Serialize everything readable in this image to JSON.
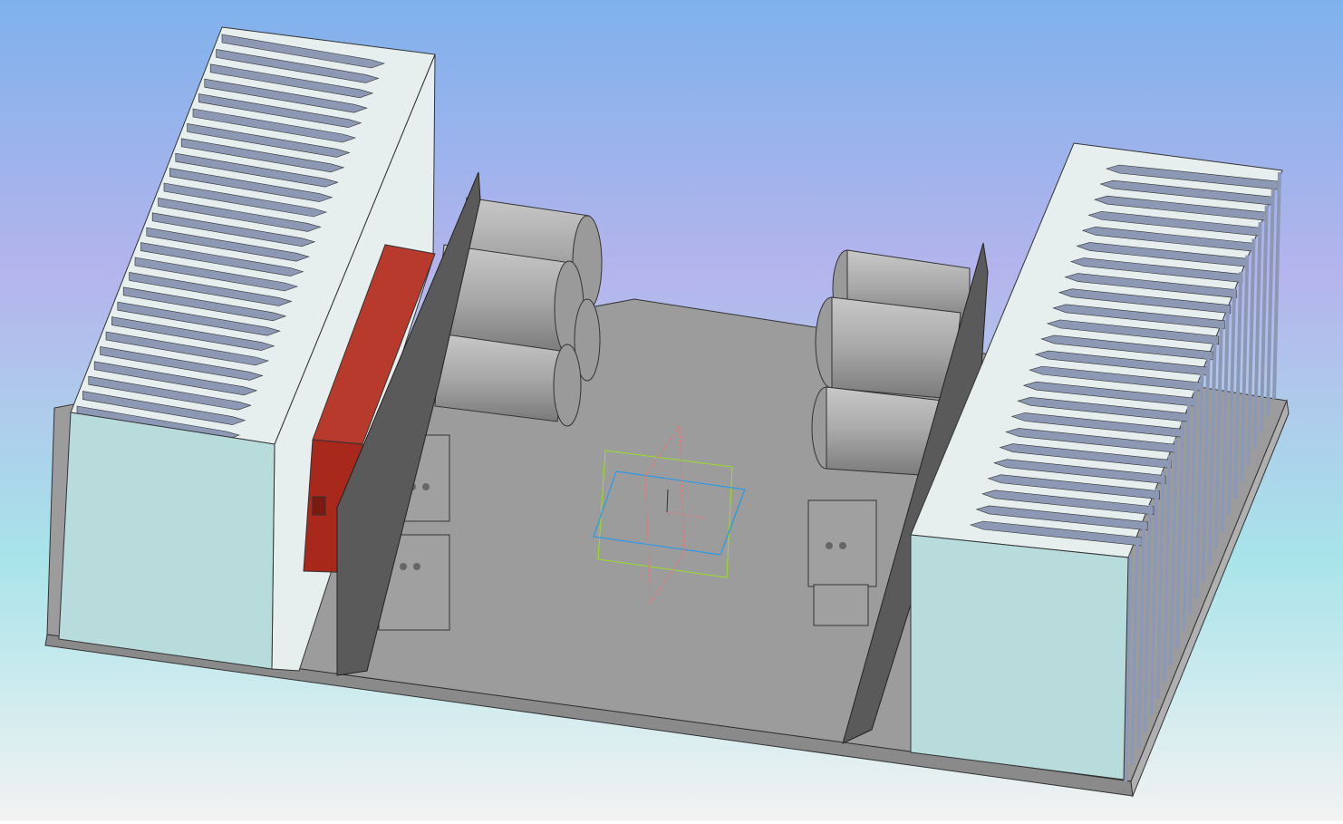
{
  "viewport": {
    "background_colors": [
      "#7fb2ec",
      "#b4b4ec",
      "#a8e4ea",
      "#f2f2f2"
    ],
    "heatsink_color": "#b8dcdc",
    "heatsink_top_color": "#e6eeee",
    "fin_color": "#8c98b4",
    "plate_color": "#9c9c9c",
    "pcb_color": "#5a5a5a",
    "capacitor_color": "#a8a8a8",
    "block_color": "#a8281c",
    "plane_colors": [
      "#9ae020",
      "#2a9ae8",
      "#f07070"
    ]
  }
}
